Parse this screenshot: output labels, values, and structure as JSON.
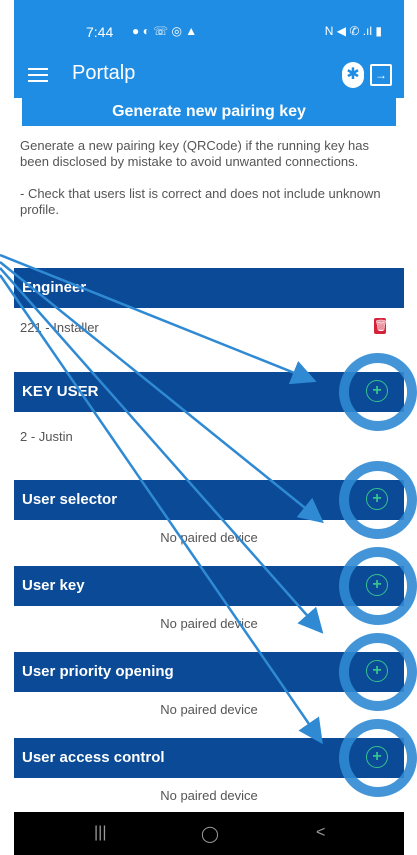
{
  "status_bar": {
    "time": "7:44",
    "left_icons": "● ◐ ☏ ◎ ▲",
    "right_icons": "N ◀ ✆ .ıl ▮"
  },
  "app_bar": {
    "title": "Portalp",
    "menu_icon": "hamburger-icon",
    "bluetooth_icon": "bluetooth-icon",
    "exit_icon": "logout-icon"
  },
  "generate_button": {
    "label": "Generate new pairing key"
  },
  "info_text": {
    "paragraph1": "Generate a new pairing key (QRCode) if the running key has been disclosed by mistake to avoid unwanted connections.",
    "paragraph2": "- Check that users list is correct and does not include unknown profile."
  },
  "sections": [
    {
      "title": "Engineer",
      "rows": [
        "221 - Installer"
      ]
    },
    {
      "title": "KEY USER",
      "rows": [
        "2 - Justin"
      ]
    },
    {
      "title": "User selector",
      "rows": [
        "No paired device"
      ]
    },
    {
      "title": "User key",
      "rows": [
        "No paired device"
      ]
    },
    {
      "title": "User priority opening",
      "rows": [
        "No paired device"
      ]
    },
    {
      "title": "User access control",
      "rows": [
        "No paired device"
      ]
    }
  ],
  "nav_bar": {
    "recent": "|||",
    "home": "◯",
    "back": "<"
  },
  "colors": {
    "primary": "#1f8de3",
    "section_header": "#0a4a96",
    "add_icon": "#34c38f",
    "delete_icon": "#d6213b",
    "annotation": "#2f8ad3"
  }
}
